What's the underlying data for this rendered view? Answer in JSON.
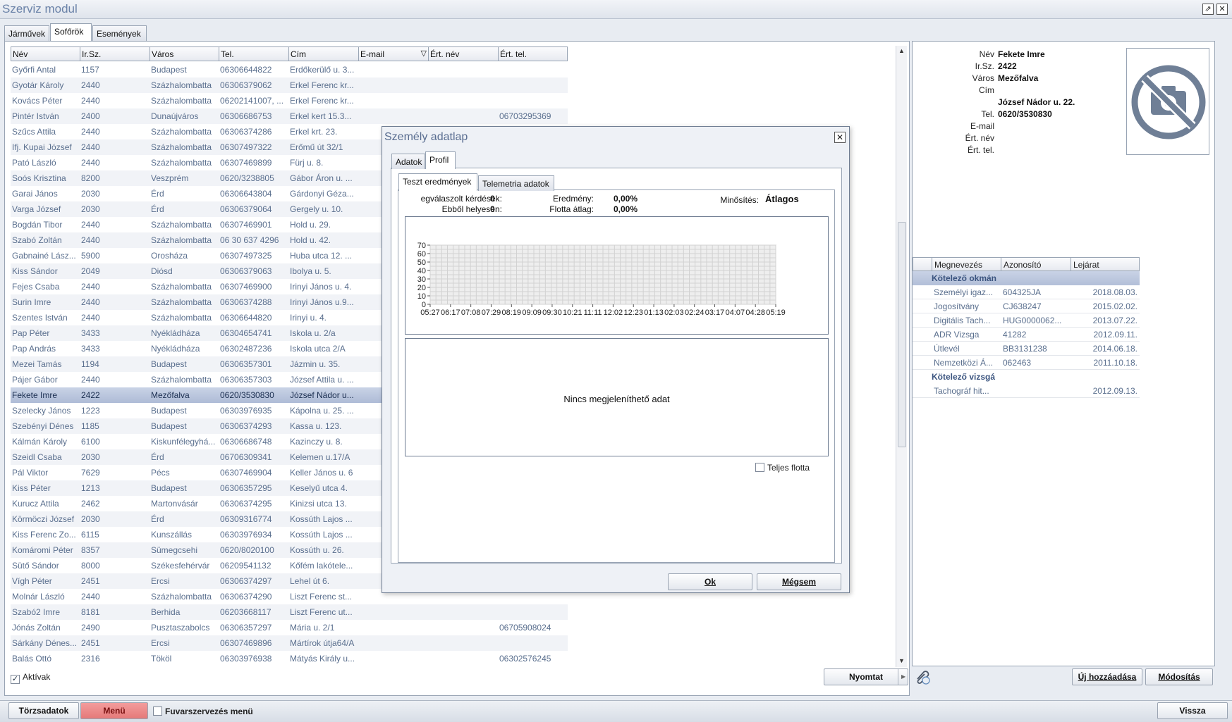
{
  "window": {
    "title": "Szerviz modul",
    "pin_glyph": "⇗",
    "close_glyph": "✕"
  },
  "main_tabs": [
    {
      "label": "Járművek",
      "active": false
    },
    {
      "label": "Sofőrök",
      "active": true
    },
    {
      "label": "Események",
      "active": false
    }
  ],
  "grid": {
    "columns": [
      "Név",
      "Ir.Sz.",
      "Város",
      "Tel.",
      "Cím",
      "E-mail",
      "Ért. név",
      "Ért. tel."
    ],
    "rows": [
      [
        "Győrfi Antal",
        "1157",
        "Budapest",
        "06306644822",
        "Erdőkerülő u. 3...",
        "",
        "",
        ""
      ],
      [
        "Gyotár Károly",
        "2440",
        "Százhalombatta",
        "06306379062",
        "Erkel Ferenc kr...",
        "",
        "",
        ""
      ],
      [
        "Kovács Péter",
        "2440",
        "Százhalombatta",
        "06202141007, ...",
        "Erkel Ferenc kr...",
        "",
        "",
        ""
      ],
      [
        "Pintér István",
        "2400",
        "Dunaújváros",
        "06306686753",
        "Erkel kert 15.3...",
        "",
        "",
        "06703295369"
      ],
      [
        "Szűcs Attila",
        "2440",
        "Százhalombatta",
        "06306374286",
        "Erkel krt. 23.",
        "",
        "",
        ""
      ],
      [
        "Ifj. Kupai József",
        "2440",
        "Százhalombatta",
        "06307497322",
        "Erőmű út 32/1",
        "",
        "",
        ""
      ],
      [
        "Pató László",
        "2440",
        "Százhalombatta",
        "06307469899",
        "Fürj u. 8.",
        "",
        "",
        ""
      ],
      [
        "Soós Krisztina",
        "8200",
        "Veszprém",
        "0620/3238805",
        "Gábor Áron u. ...",
        "",
        "",
        ""
      ],
      [
        "Garai János",
        "2030",
        "Érd",
        "06306643804",
        "Gárdonyi Géza...",
        "",
        "",
        ""
      ],
      [
        "Varga József",
        "2030",
        "Érd",
        "06306379064",
        "Gergely u. 10.",
        "",
        "",
        ""
      ],
      [
        "Bogdán Tibor",
        "2440",
        "Százhalombatta",
        "06307469901",
        "Hold u. 29.",
        "",
        "",
        ""
      ],
      [
        "Szabó Zoltán",
        "2440",
        "Százhalombatta",
        "06 30 637 4296",
        "Hold u. 42.",
        "",
        "",
        ""
      ],
      [
        "Gabnainé Lász...",
        "5900",
        "Orosháza",
        "06307497325",
        "Huba utca 12. ...",
        "",
        "",
        ""
      ],
      [
        "Kiss Sándor",
        "2049",
        "Diósd",
        "06306379063",
        "Ibolya u. 5.",
        "",
        "",
        ""
      ],
      [
        "Fejes Csaba",
        "2440",
        "Százhalombatta",
        "06307469900",
        "Irinyi János u. 4.",
        "",
        "",
        ""
      ],
      [
        "Surin Imre",
        "2440",
        "Százhalombatta",
        "06306374288",
        "Irinyi János u.9...",
        "",
        "",
        ""
      ],
      [
        "Szentes István",
        "2440",
        "Százhalombatta",
        "06306644820",
        "Irinyi u. 4.",
        "",
        "",
        ""
      ],
      [
        "Pap Péter",
        "3433",
        "Nyékládháza",
        "06304654741",
        "Iskola u. 2/a",
        "",
        "",
        ""
      ],
      [
        "Pap András",
        "3433",
        "Nyékládháza",
        "06302487236",
        "Iskola utca 2/A",
        "",
        "",
        ""
      ],
      [
        "Mezei Tamás",
        "1194",
        "Budapest",
        "06306357301",
        "Jázmin u. 35.",
        "",
        "",
        ""
      ],
      [
        "Pájer Gábor",
        "2440",
        "Százhalombatta",
        "06306357303",
        "József Attila u. ...",
        "",
        "",
        ""
      ],
      [
        "Fekete Imre",
        "2422",
        "Mezőfalva",
        "0620/3530830",
        "József Nádor u...",
        "",
        "",
        ""
      ],
      [
        "Szelecky János",
        "1223",
        "Budapest",
        "06303976935",
        "Kápolna u. 25. ...",
        "",
        "",
        ""
      ],
      [
        "Szebényi Dénes",
        "1185",
        "Budapest",
        "06306374293",
        "Kassa u. 123.",
        "",
        "",
        ""
      ],
      [
        "Kálmán Károly",
        "6100",
        "Kiskunfélegyhá...",
        "06306686748",
        "Kazinczy u. 8.",
        "",
        "",
        ""
      ],
      [
        "Szeidl Csaba",
        "2030",
        "Érd",
        "06706309341",
        "Kelemen u.17/A",
        "",
        "",
        ""
      ],
      [
        "Pál Viktor",
        "7629",
        "Pécs",
        "06307469904",
        "Keller János u. 6",
        "",
        "",
        ""
      ],
      [
        "Kiss Péter",
        "1213",
        "Budapest",
        "06306357295",
        "Keselyű utca 4.",
        "",
        "",
        ""
      ],
      [
        "Kurucz Attila",
        "2462",
        "Martonvásár",
        "06306374295",
        "Kinizsi utca 13.",
        "",
        "",
        ""
      ],
      [
        "Körmöczi József",
        "2030",
        "Érd",
        "06309316774",
        "Kossúth Lajos ...",
        "",
        "",
        ""
      ],
      [
        "Kiss Ferenc Zo...",
        "6115",
        "Kunszállás",
        "06303976934",
        "Kossúth Lajos ...",
        "",
        "",
        ""
      ],
      [
        "Komáromi Péter",
        "8357",
        "Sümegcsehi",
        "0620/8020100",
        "Kossúth u. 26.",
        "",
        "",
        ""
      ],
      [
        "Sütő Sándor",
        "8000",
        "Székesfehérvár",
        "06209541132",
        "Kőfém lakótele...",
        "",
        "",
        ""
      ],
      [
        "Vígh Péter",
        "2451",
        "Ercsi",
        "06306374297",
        "Lehel út 6.",
        "",
        "",
        ""
      ],
      [
        "Molnár László",
        "2440",
        "Százhalombatta",
        "06306374290",
        "Liszt Ferenc st...",
        "",
        "",
        ""
      ],
      [
        "Szabó2 Imre",
        "8181",
        "Berhida",
        "06203668117",
        "Liszt Ferenc ut...",
        "",
        "",
        ""
      ],
      [
        "Jónás Zoltán",
        "2490",
        "Pusztaszabolcs",
        "06306357297",
        "Mária u. 2/1",
        "",
        "",
        "06705908024"
      ],
      [
        "Sárkány Dénes...",
        "2451",
        "Ercsi",
        "06307469896",
        "Mártírok útja64/A",
        "",
        "",
        ""
      ],
      [
        "Balás Ottó",
        "2316",
        "Tököl",
        "06303976938",
        "Mátyás Király u...",
        "",
        "",
        "06302576245"
      ]
    ],
    "selected_index": 21
  },
  "active_filter": {
    "label": "Aktívak",
    "checked": true
  },
  "detail": {
    "labels": {
      "name": "Név",
      "zip": "Ir.Sz.",
      "city": "Város",
      "address": "Cím",
      "phone": "Tel.",
      "email": "E-mail",
      "contact_name": "Ért. név",
      "contact_phone": "Ért. tel."
    },
    "name": "Fekete Imre",
    "zip": "2422",
    "city": "Mezőfalva",
    "address": "József Nádor u. 22.",
    "phone": "0620/3530830",
    "email": "",
    "contact_name": "",
    "contact_phone": "",
    "photo_icon": "no-photo-icon"
  },
  "documents": {
    "columns": [
      "Megnevezés",
      "Azonosító",
      "Lejárat"
    ],
    "groups": [
      {
        "title": "Kötelező okmán",
        "rows": [
          [
            "Személyi igaz...",
            "604325JA",
            "2018.08.03."
          ],
          [
            "Jogosítvány",
            "CJ638247",
            "2015.02.02."
          ],
          [
            "Digitális Tach...",
            "HUG0000062...",
            "2013.07.22."
          ],
          [
            "ADR Vizsga",
            "41282",
            "2012.09.11."
          ],
          [
            "Útlevél",
            "BB3131238",
            "2014.06.18."
          ],
          [
            "Nemzetközi Á...",
            "062463",
            "2011.10.18."
          ]
        ]
      },
      {
        "title": "Kötelező vizsgá",
        "rows": [
          [
            "Tachográf hit...",
            "",
            "2012.09.13."
          ]
        ]
      }
    ]
  },
  "buttons": {
    "print": "Nyomtat",
    "add_new": "Új hozzáadása",
    "modify": "Módosítás",
    "back": "Vissza",
    "master_data": "Törzsadatok",
    "menu": "Menü",
    "transport_menu": "Fuvarszervezés menü"
  },
  "dialog": {
    "title": "Személy adatlap",
    "tabs": [
      "Adatok",
      "Profil"
    ],
    "subtabs": [
      "Teszt eredmények",
      "Telemetria adatok"
    ],
    "stats": {
      "answered_label": "egválaszolt kérdések:",
      "answered_value": "0",
      "correct_label": "Ebből helyesen:",
      "correct_value": "0",
      "result_label": "Eredmény:",
      "result_value": "0,00%",
      "fleet_avg_label": "Flotta átlag:",
      "fleet_avg_value": "0,00%",
      "rating_label": "Minősítés:",
      "rating_value": "Átlagos"
    },
    "no_data": "Nincs megjeleníthető adat",
    "full_fleet_label": "Teljes flotta",
    "ok": "Ok",
    "cancel": "Mégsem"
  },
  "chart_data": {
    "type": "line",
    "x": [
      "05:27",
      "06:17",
      "07:08",
      "07:29",
      "08:19",
      "09:09",
      "09:30",
      "10:21",
      "11:11",
      "12:02",
      "12:23",
      "01:13",
      "02:03",
      "02:24",
      "03:17",
      "04:07",
      "04:28",
      "05:19"
    ],
    "series": [],
    "ylim": [
      0,
      70
    ],
    "yticks": [
      0,
      10,
      20,
      30,
      40,
      50,
      60,
      70
    ],
    "grid": true,
    "title": "",
    "xlabel": "",
    "ylabel": ""
  }
}
